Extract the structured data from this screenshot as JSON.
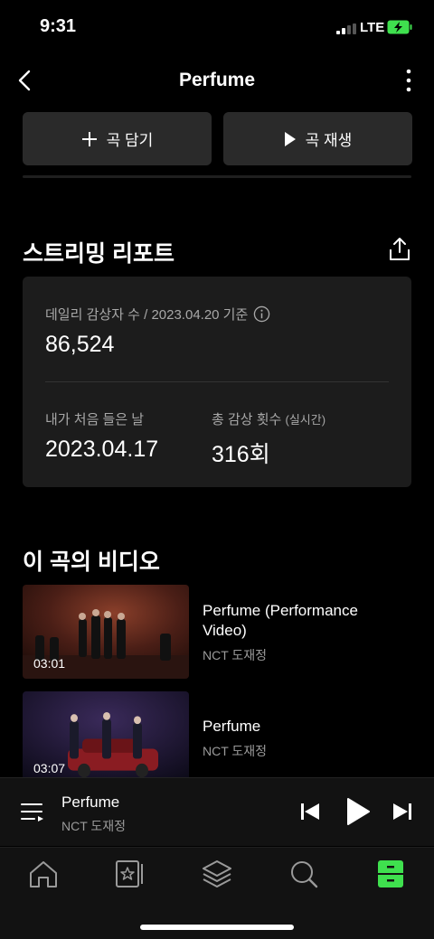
{
  "status_bar": {
    "time": "9:31",
    "network": "LTE"
  },
  "header": {
    "title": "Perfume"
  },
  "actions": {
    "add_label": "곡 담기",
    "play_label": "곡 재생"
  },
  "report": {
    "section_title": "스트리밍 리포트",
    "daily_label": "데일리 감상자 수 / 2023.04.20 기준",
    "daily_value": "86,524",
    "first_listen_label": "내가 처음 들은 날",
    "first_listen_value": "2023.04.17",
    "total_plays_label": "총 감상 횟수",
    "total_plays_suffix": "(실시간)",
    "total_plays_value": "316회"
  },
  "videos": {
    "section_title": "이 곡의 비디오",
    "items": [
      {
        "title": "Perfume (Performance Video)",
        "artist": "NCT 도재정",
        "duration": "03:01"
      },
      {
        "title": "Perfume",
        "artist": "NCT 도재정",
        "duration": "03:07"
      }
    ]
  },
  "mini_player": {
    "title": "Perfume",
    "artist": "NCT 도재정"
  },
  "colors": {
    "accent": "#3fe04e",
    "background": "#000000",
    "card": "#1c1c1c",
    "button": "#2a2a2a"
  },
  "icons": [
    "back-icon",
    "more-icon",
    "plus-icon",
    "play-icon",
    "share-icon",
    "info-icon",
    "queue-icon",
    "previous-icon",
    "next-icon",
    "home-icon",
    "playlist-icon",
    "layers-icon",
    "search-icon",
    "library-icon"
  ]
}
